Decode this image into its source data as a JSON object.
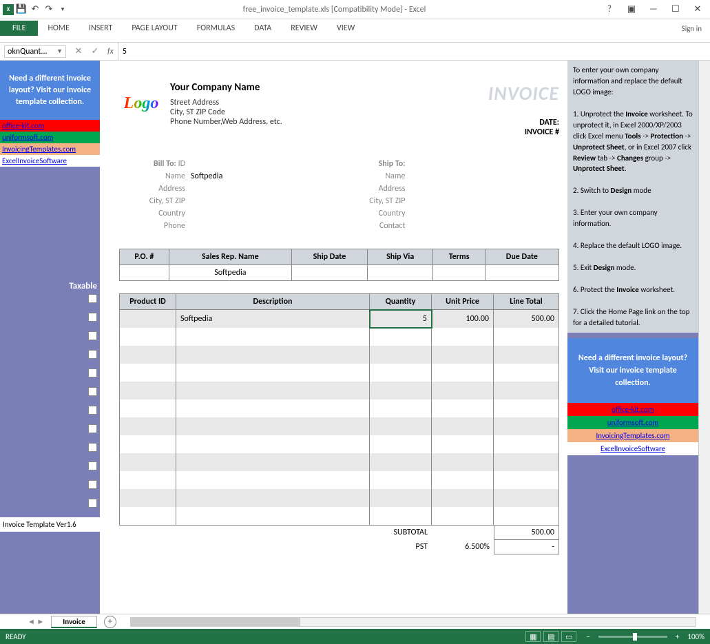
{
  "titlebar": {
    "title": "free_invoice_template.xls  [Compatibility Mode] - Excel"
  },
  "ribbon": {
    "file": "FILE",
    "tabs": [
      "HOME",
      "INSERT",
      "PAGE LAYOUT",
      "FORMULAS",
      "DATA",
      "REVIEW",
      "VIEW"
    ],
    "signin": "Sign in"
  },
  "formula_bar": {
    "name_box": "oknQuant...",
    "fx": "fx",
    "value": "5"
  },
  "left_sidebar": {
    "promo": "Need a different invoice layout? Visit our invoice template collection.",
    "links": [
      "office-kit.com",
      "uniformsoft.com",
      "InvoicingTemplates.com",
      "ExcelInvoiceSoftware"
    ],
    "taxable": "Taxable",
    "version": "Invoice Template Ver1.6"
  },
  "invoice": {
    "logo": "Logo",
    "company_name": "Your Company Name",
    "addr1": "Street Address",
    "addr2": "City, ST  ZIP Code",
    "addr3": "Phone Number,Web Address, etc.",
    "title": "INVOICE",
    "date_label": "DATE:",
    "invno_label": "INVOICE #",
    "bill_to": "Bill To:",
    "ship_to": "Ship To:",
    "bill_labels": [
      "ID",
      "Name",
      "Address",
      "City, ST ZIP",
      "Country",
      "Phone"
    ],
    "ship_labels": [
      "Name",
      "Address",
      "City, ST ZIP",
      "Country",
      "Contact"
    ],
    "bill_name": "Softpedia",
    "po_headers": [
      "P.O. #",
      "Sales Rep. Name",
      "Ship Date",
      "Ship Via",
      "Terms",
      "Due Date"
    ],
    "po_row": [
      "",
      "Softpedia",
      "",
      "",
      "",
      ""
    ],
    "item_headers": [
      "Product ID",
      "Description",
      "Quantity",
      "Unit Price",
      "Line Total"
    ],
    "item_row": {
      "desc": "Softpedia",
      "qty": "5",
      "price": "100.00",
      "total": "500.00"
    },
    "subtotal_label": "SUBTOTAL",
    "subtotal": "500.00",
    "pst_label": "PST",
    "pst_rate": "6.500%",
    "pst_val": "-"
  },
  "right_sidebar": {
    "instructions_html": "To enter your own company information and replace the default LOGO image:<br><br>1. Unprotect the <b>Invoice</b> worksheet. To unprotect it, in Excel 2000/XP/2003 click Excel menu <b>Tools</b> -> <b>Protection</b> -> <b>Unprotect Sheet</b>, or in Excel 2007 click <b>Review</b> tab -> <b>Changes</b> group -> <b>Unprotect Sheet</b>.<br><br>2. Switch to <b>Design</b> mode<br><br>3. Enter your own company information.<br><br>4. Replace the default LOGO image.<br><br>5. Exit <b>Design</b> mode.<br><br>6. Protect the <b>Invoice</b> worksheet.<br><br>7. Click the Home Page link on the top for a detailed tutorial.",
    "promo": "Need a different invoice layout? Visit our invoice template collection.",
    "links": [
      "office-kit.com",
      "uniformsoft.com",
      "InvoicingTemplates.com",
      "ExcelInvoiceSoftware"
    ]
  },
  "sheet_tabs": {
    "active": "Invoice"
  },
  "status": {
    "ready": "READY",
    "zoom": "100%"
  }
}
